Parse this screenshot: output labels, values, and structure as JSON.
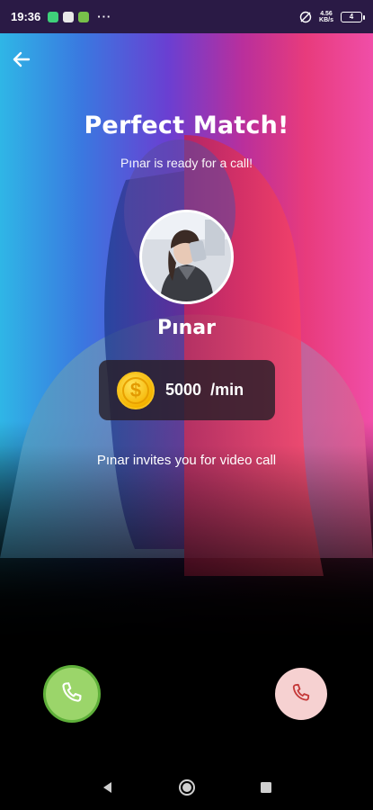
{
  "status_bar": {
    "time": "19:36",
    "network_top": "4.56",
    "network_bottom": "KB/s",
    "battery": "4"
  },
  "header": {
    "title": "Perfect Match!",
    "subtitle": "Pınar is ready for a call!"
  },
  "profile": {
    "name": "Pınar"
  },
  "price": {
    "amount": "5000",
    "unit": "/min",
    "coin_symbol": "$"
  },
  "invite_text": "Pınar invites you for video call",
  "colors": {
    "accept": "#9bd56a",
    "decline": "#f6d1d1",
    "gradient_left": "#2fb6e6",
    "gradient_right": "#f04ea8"
  },
  "icons": {
    "back": "arrow-left-icon",
    "accept": "phone-icon",
    "decline": "phone-icon",
    "coin": "coin-icon"
  }
}
